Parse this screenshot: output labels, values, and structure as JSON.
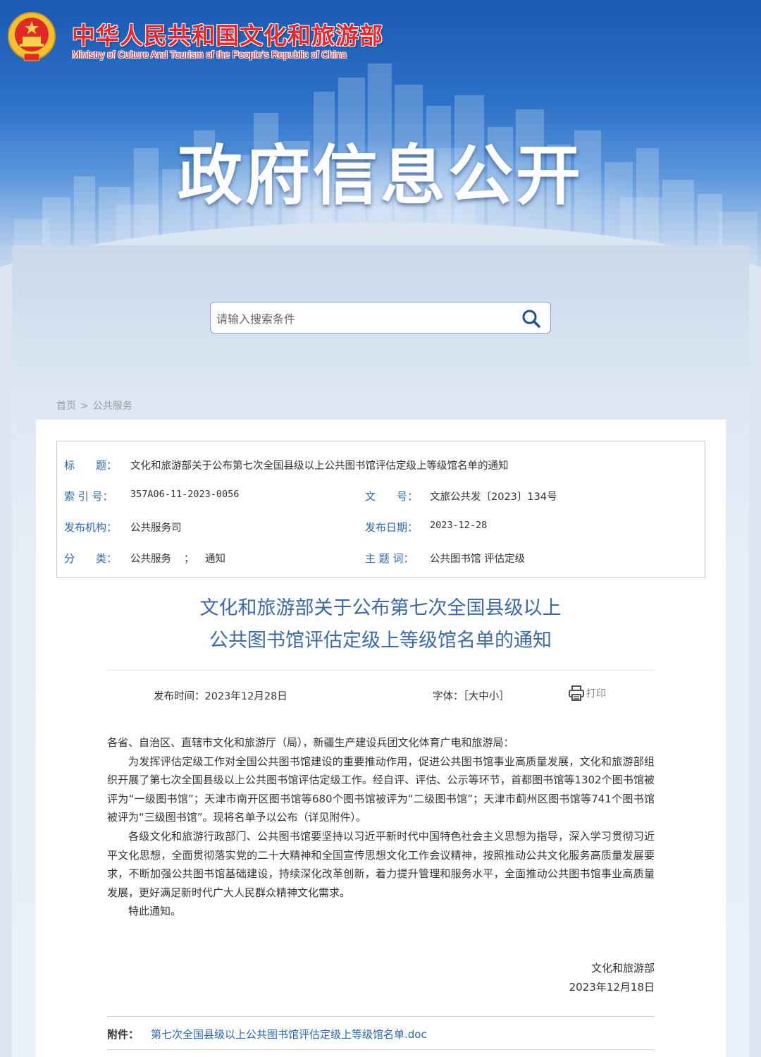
{
  "header": {
    "site_title": "中华人民共和国文化和旅游部",
    "site_subtitle": "Ministry of Culture And Tourism of the People’s Republic of China",
    "banner_heading": "政府信息公开",
    "emblem_icon": "national-emblem-icon"
  },
  "search": {
    "placeholder": "请输入搜索条件",
    "button_icon": "search-icon"
  },
  "breadcrumb": {
    "home": "首页",
    "separator": ">",
    "current": "公共服务"
  },
  "meta": {
    "title_label": "标　　题：",
    "title_value": "文化和旅游部关于公布第七次全国县级以上公共图书馆评估定级上等级馆名单的通知",
    "index_label": "索 引 号：",
    "index_value": "357A06-11-2023-0056",
    "docno_label": "文　　号：",
    "docno_value": "文旅公共发〔2023〕134号",
    "org_label": "发布机构：",
    "org_value": "公共服务司",
    "date_label": "发布日期：",
    "date_value": "2023-12-28",
    "category_label": "分　　类：",
    "category_value_1": "公共服务",
    "category_sep": "；",
    "category_value_2": "通知",
    "keywords_label": "主 题 词：",
    "keywords_value": "公共图书馆 评估定级"
  },
  "article": {
    "title_line1": "文化和旅游部关于公布第七次全国县级以上",
    "title_line2": "公共图书馆评估定级上等级馆名单的通知",
    "publish_time": "发布时间：2023年12月28日",
    "font_size": "字体：［大中小］",
    "print_label": "打印",
    "print_icon": "printer-icon",
    "salutation": "各省、自治区、直辖市文化和旅游厅（局），新疆生产建设兵团文化体育广电和旅游局：",
    "para1": "为发挥评估定级工作对全国公共图书馆建设的重要推动作用，促进公共图书馆事业高质量发展，文化和旅游部组织开展了第七次全国县级以上公共图书馆评估定级工作。经自评、评估、公示等环节，首都图书馆等1302个图书馆被评为“一级图书馆”；天津市南开区图书馆等680个图书馆被评为“二级图书馆”；天津市蓟州区图书馆等741个图书馆被评为“三级图书馆”。现将名单予以公布（详见附件）。",
    "para2": "各级文化和旅游行政部门、公共图书馆要坚持以习近平新时代中国特色社会主义思想为指导，深入学习贯彻习近平文化思想，全面贯彻落实党的二十大精神和全国宣传思想文化工作会议精神，按照推动公共文化服务高质量发展要求，不断加强公共图书馆基础建设，持续深化改革创新，着力提升管理和服务水平，全面推动公共图书馆事业高质量发展，更好满足新时代广大人民群众精神文化需求。",
    "para3": "特此通知。",
    "signer": "文化和旅游部",
    "sign_date": "2023年12月18日",
    "attachment_label": "附件：",
    "attachment_link": "第七次全国县级以上公共图书馆评估定级上等级馆名单.doc"
  },
  "colors": {
    "banner_top": "#1b59b3",
    "title_red": "#e8262b",
    "label_blue": "#2767b5",
    "article_title_blue": "#3b6aa8"
  }
}
